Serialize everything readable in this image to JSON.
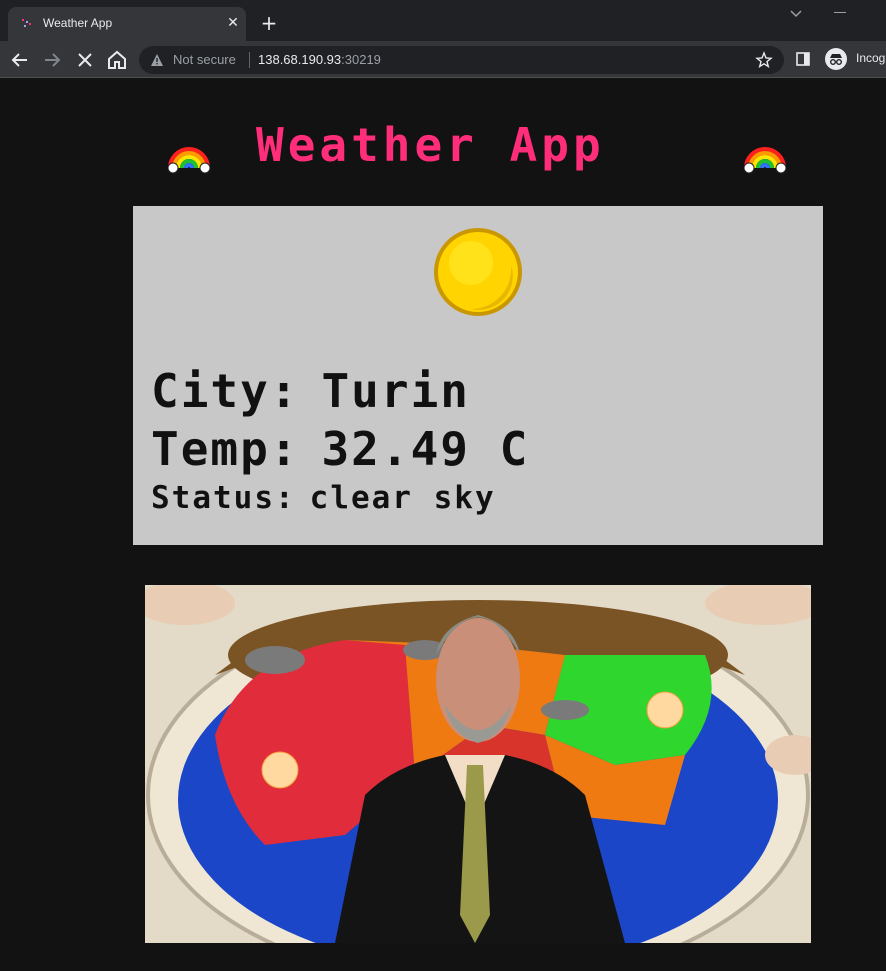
{
  "browser": {
    "tab_title": "Weather App",
    "tab_close": "✕",
    "new_tab": "+",
    "security_label": "Not secure",
    "url_host": "138.68.190.93",
    "url_port": ":30219",
    "profile_label": "Incognito"
  },
  "page": {
    "title": "Weather App",
    "title_icon": "rainbow-icon",
    "weather_icon": "sun-icon"
  },
  "weather": {
    "city_label": "City:",
    "city_value": "Turin",
    "temp_label": "Temp:",
    "temp_value": "32.49 C",
    "status_label": "Status:",
    "status_value": "clear sky"
  },
  "media": {
    "gif_subject": "weatherman-map-gif"
  },
  "colors": {
    "title_pink": "#ff2d7a",
    "card_bg": "#c8c8c8",
    "page_bg": "#121212",
    "sun_yellow": "#ffd400"
  }
}
